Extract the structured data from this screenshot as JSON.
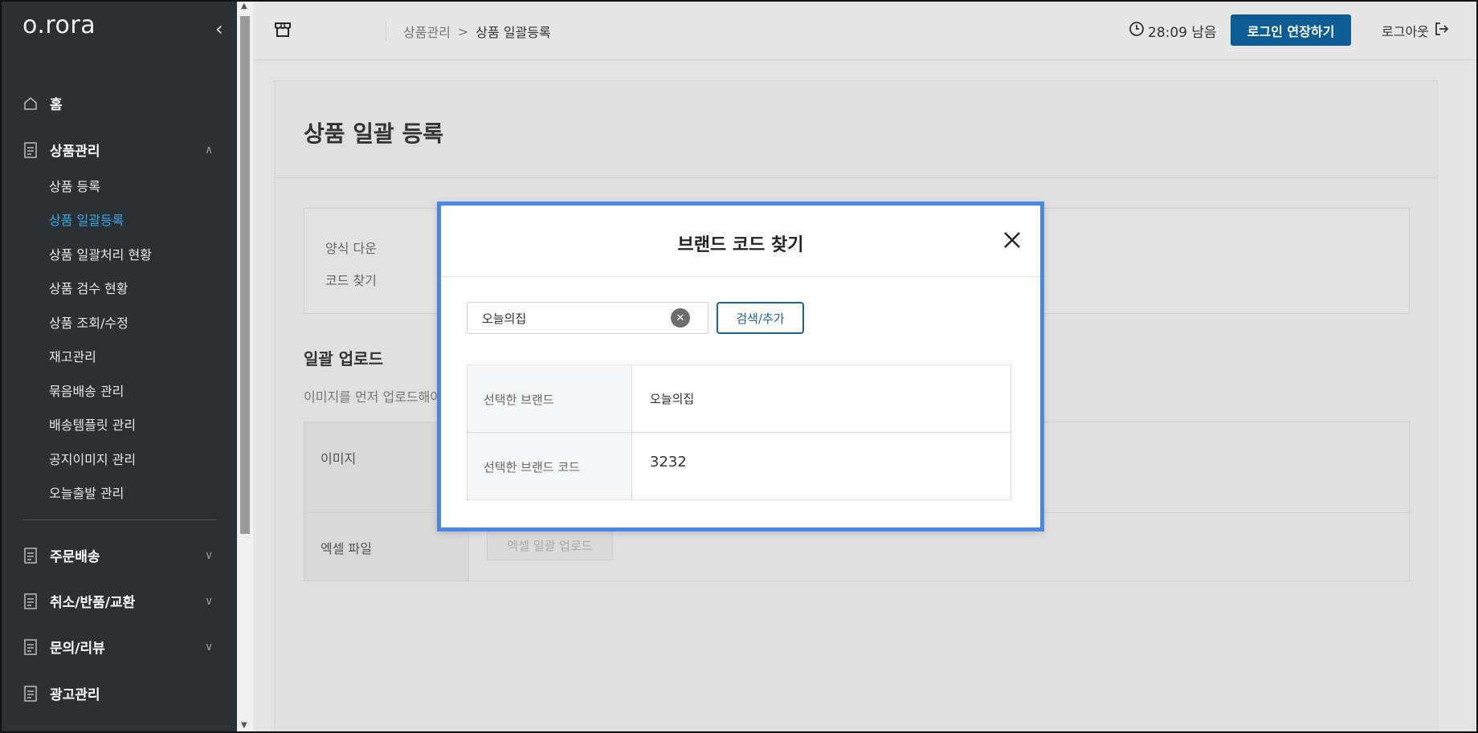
{
  "sidebar": {
    "logo": "o.rora",
    "home": "홈",
    "product_mgmt": "상품관리",
    "sub_items": [
      "상품 등록",
      "상품 일괄등록",
      "상품 일괄처리 현황",
      "상품 검수 현황",
      "상품 조회/수정",
      "재고관리",
      "묶음배송 관리",
      "배송템플릿 관리",
      "공지이미지 관리",
      "오늘출발 관리"
    ],
    "order_delivery": "주문배송",
    "cancel_return": "취소/반품/교환",
    "inquiry_review": "문의/리뷰",
    "ad_mgmt": "광고관리"
  },
  "header": {
    "breadcrumb": {
      "parent": "상품관리",
      "separator": ">",
      "current": "상품 일괄등록"
    },
    "timer": "28:09 남음",
    "extend_label": "로그인 연장하기",
    "logout_label": "로그아웃"
  },
  "page": {
    "title": "상품 일괄 등록",
    "info_line1": "양식 다운",
    "info_line2": "코드 찾기",
    "upload_title": "일괄 업로드",
    "upload_desc": "이미지를 먼저 업로드해야",
    "row_image_label": "이미지",
    "row_excel_label": "엑셀 파일",
    "excel_button": "엑셀 일괄 업로드"
  },
  "modal": {
    "title": "브랜드 코드 찾기",
    "search_value": "오늘의집",
    "search_button": "검색/추가",
    "selected_brand_label": "선택한 브랜드",
    "selected_brand_value": "오늘의집",
    "selected_code_label": "선택한 브랜드 코드",
    "selected_code_value": "3232"
  },
  "colors": {
    "sidebar_bg": "#2b3034",
    "active_link": "#3aa3e3",
    "primary_button": "#0d5c96",
    "modal_border": "#4a86e8"
  }
}
